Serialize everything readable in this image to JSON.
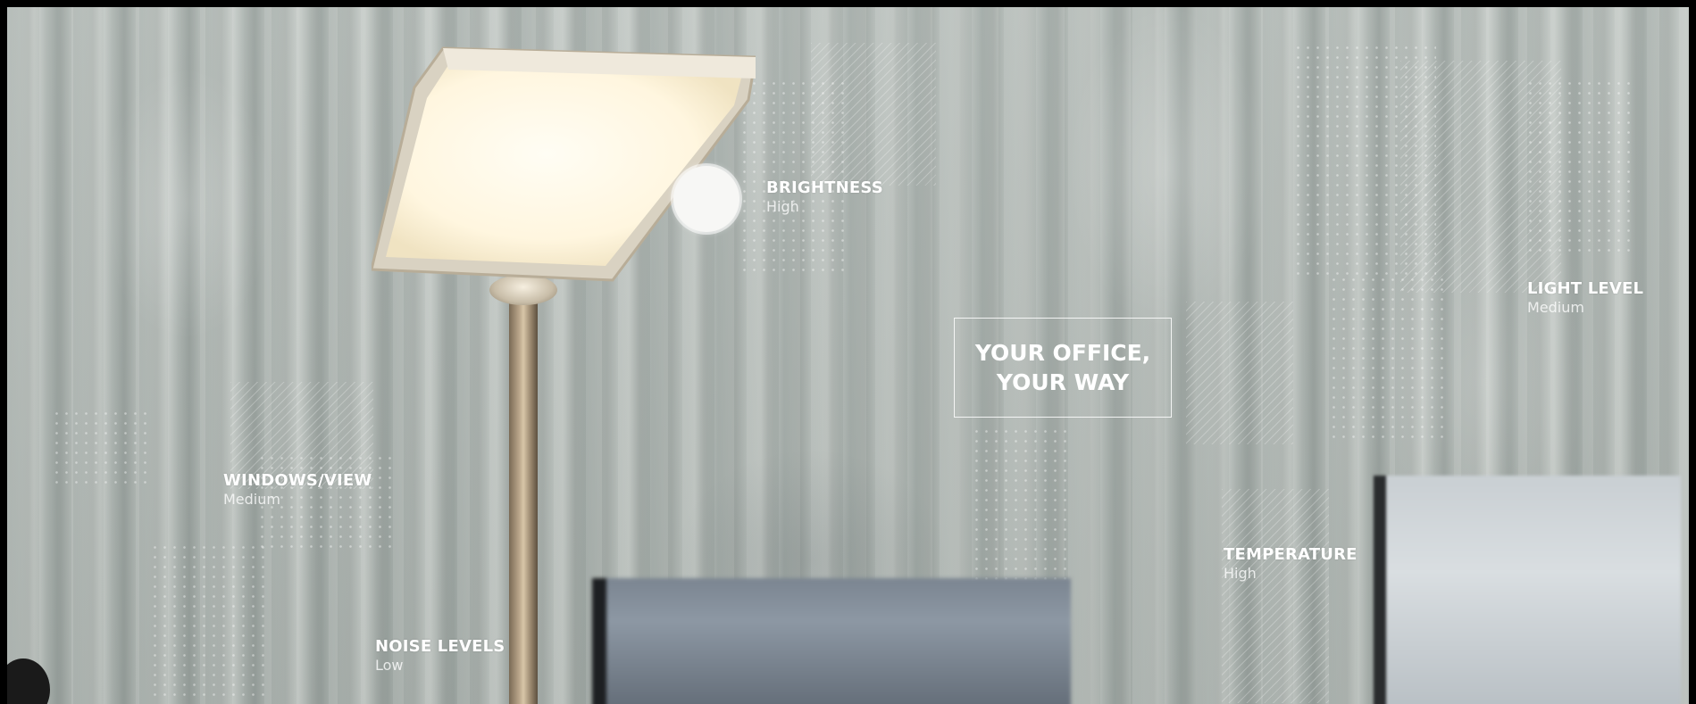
{
  "headline": {
    "line1": "YOUR OFFICE,",
    "line2": "YOUR WAY"
  },
  "metrics": {
    "brightness": {
      "name": "BRIGHTNESS",
      "value": "High"
    },
    "light_level": {
      "name": "LIGHT LEVEL",
      "value": "Medium"
    },
    "windows_view": {
      "name": "WINDOWS/VIEW",
      "value": "Medium"
    },
    "temperature": {
      "name": "TEMPERATURE",
      "value": "High"
    },
    "noise_levels": {
      "name": "NOISE LEVELS",
      "value": "Low"
    }
  },
  "colors": {
    "text": "#ffffff",
    "background_wall": "#b5bcb8"
  }
}
